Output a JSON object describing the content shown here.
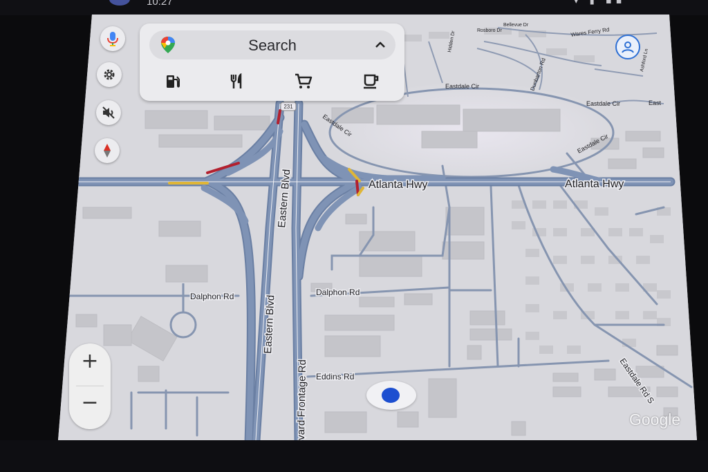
{
  "status_bar": {
    "time": "10:27",
    "icons": "▾ ▮ ▪▪"
  },
  "map_controls": [
    {
      "name": "voice-search",
      "icon": "microphone-icon"
    },
    {
      "name": "settings",
      "icon": "gear-icon"
    },
    {
      "name": "mute",
      "icon": "speaker-muted-icon"
    },
    {
      "name": "compass",
      "icon": "compass-icon"
    }
  ],
  "search": {
    "label": "Search",
    "collapse_icon": "chevron-up-icon",
    "logo_icon": "google-maps-pin-icon",
    "categories": [
      {
        "name": "gas",
        "icon": "gas-station-icon"
      },
      {
        "name": "restaurants",
        "icon": "restaurant-icon"
      },
      {
        "name": "grocery",
        "icon": "shopping-cart-icon"
      },
      {
        "name": "coffee",
        "icon": "coffee-icon"
      }
    ]
  },
  "account": {
    "icon": "account-circle-icon",
    "color": "#2d6fd4"
  },
  "zoom": {
    "in_label": "+",
    "out_label": "−"
  },
  "map_labels": {
    "atlanta_hwy_west": "Atlanta Hwy",
    "atlanta_hwy_east": "Atlanta Hwy",
    "eastern_blvd_north": "Eastern Blvd",
    "eastern_blvd_south": "Eastern Blvd",
    "dalphon_rd_west": "Dalphon Rd",
    "dalphon_rd_east": "Dalphon Rd",
    "frontage_rd": "vard Frontage Rd",
    "eddins_rd": "Eddins Rd",
    "eastdale_rd_s": "Eastdale Rd S",
    "eastdale_cir_1": "Eastdale Cir",
    "eastdale_cir_2": "Eastdale Cir",
    "eastdale_cir_3": "Eastdale Cir",
    "eastdale_cir_4": "Eastdale Cir",
    "east": "East",
    "route_shield": "231",
    "dunbarton_rd": "Dunbarton Rd",
    "wares_ferry_rd": "Wares Ferry Rd",
    "bellevue_dr": "Bellevue Dr",
    "rosboro_dr": "Rosboro Dr",
    "ashford_ln": "Ashford Ln",
    "hidden_dr": "Hidden Dr"
  },
  "brand": {
    "logo_text": "Google"
  },
  "colors": {
    "road": "#7f93b5",
    "road_edge": "#6a7fa3",
    "traffic_slow": "#e0b636",
    "traffic_heavy": "#b3202e",
    "location_dot": "#1d4fd0"
  }
}
